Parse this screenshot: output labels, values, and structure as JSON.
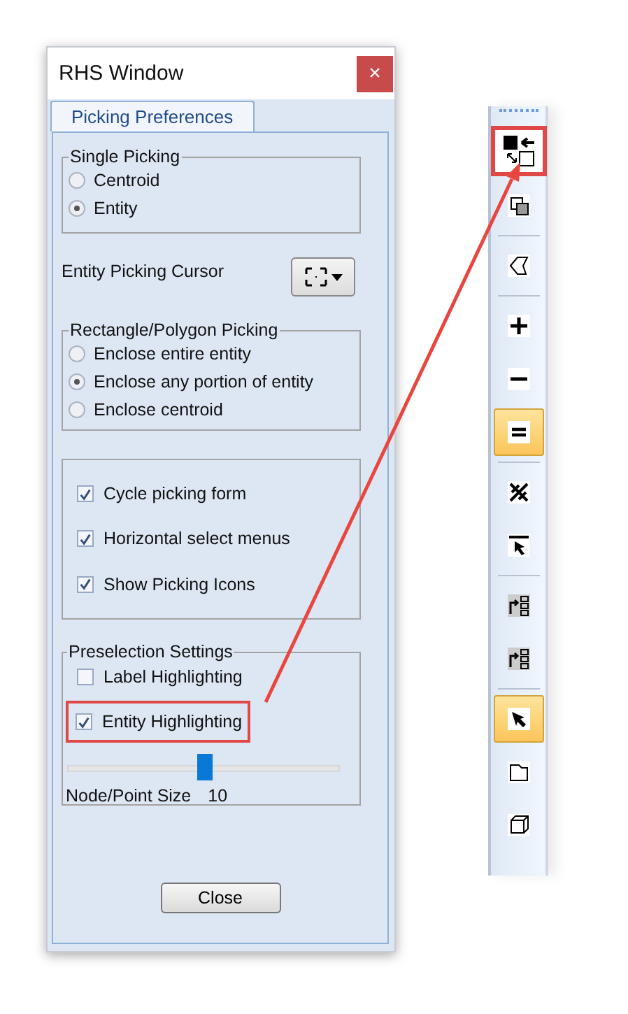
{
  "window": {
    "title": "RHS Window",
    "close": "×"
  },
  "tabs": [
    {
      "label": "Picking Preferences",
      "selected": true
    }
  ],
  "single_picking": {
    "title": "Single Picking",
    "options": [
      {
        "label": "Centroid",
        "selected": false
      },
      {
        "label": "Entity",
        "selected": true
      }
    ]
  },
  "cursor": {
    "label": "Entity Picking Cursor"
  },
  "rect_picking": {
    "title": "Rectangle/Polygon Picking",
    "options": [
      {
        "label": "Enclose entire entity",
        "selected": false
      },
      {
        "label": "Enclose any portion of entity",
        "selected": true
      },
      {
        "label": "Enclose centroid",
        "selected": false
      }
    ]
  },
  "options": [
    {
      "label": "Cycle picking form",
      "checked": true
    },
    {
      "label": "Horizontal select menus",
      "checked": true
    },
    {
      "label": "Show Picking Icons",
      "checked": true
    }
  ],
  "preselection": {
    "title": "Preselection Settings",
    "options": [
      {
        "label": "Label Highlighting",
        "checked": false,
        "highlighted": false
      },
      {
        "label": "Entity Highlighting",
        "checked": true,
        "highlighted": true
      }
    ],
    "slider": {
      "level": 0.5,
      "label": "Node/Point Size",
      "value": "10"
    }
  },
  "buttons": [
    "Close"
  ],
  "toolbar": [
    {
      "kind": "tool",
      "selected": false,
      "highlighted": true
    },
    {
      "kind": "tool",
      "selected": false,
      "highlighted": false
    },
    {
      "kind": "separator"
    },
    {
      "kind": "tool",
      "selected": false,
      "highlighted": false
    },
    {
      "kind": "separator"
    },
    {
      "kind": "tool",
      "selected": false,
      "highlighted": false
    },
    {
      "kind": "tool",
      "selected": false,
      "highlighted": false
    },
    {
      "kind": "tool",
      "selected": true,
      "highlighted": false
    },
    {
      "kind": "separator"
    },
    {
      "kind": "tool",
      "selected": false,
      "highlighted": false
    },
    {
      "kind": "tool",
      "selected": false,
      "highlighted": false
    },
    {
      "kind": "separator"
    },
    {
      "kind": "tool",
      "selected": false,
      "highlighted": false
    },
    {
      "kind": "tool",
      "selected": false,
      "highlighted": false
    },
    {
      "kind": "separator"
    },
    {
      "kind": "tool",
      "selected": true,
      "highlighted": false
    },
    {
      "kind": "tool",
      "selected": false,
      "highlighted": false
    },
    {
      "kind": "tool",
      "selected": false,
      "highlighted": false
    }
  ]
}
